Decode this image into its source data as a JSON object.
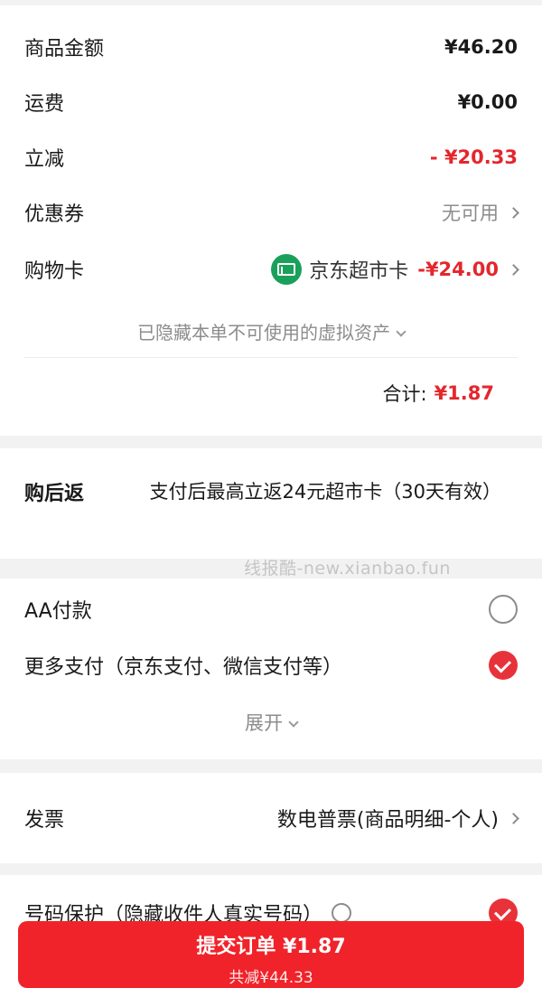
{
  "price": {
    "goods_amount_label": "商品金额",
    "goods_amount_value": "¥46.20",
    "shipping_label": "运费",
    "shipping_value": "¥0.00",
    "discount_label": "立减",
    "discount_value": "- ¥20.33",
    "coupon_label": "优惠券",
    "coupon_value": "无可用",
    "gift_card_label": "购物卡",
    "gift_card_name": "京东超市卡",
    "gift_card_value": "-¥24.00",
    "hidden_assets_text": "已隐藏本单不可使用的虚拟资产",
    "total_label": "合计:",
    "total_value": "¥1.87"
  },
  "cashback": {
    "label": "购后返",
    "text": "支付后最高立返24元超市卡（30天有效）"
  },
  "watermark": "线报酷-new.xianbao.fun",
  "payment": {
    "aa_label": "AA付款",
    "more_label": "更多支付（京东支付、微信支付等）",
    "expand_label": "展开"
  },
  "invoice": {
    "label": "发票",
    "value": "数电普票(商品明细-个人)"
  },
  "privacy": {
    "label": "号码保护（隐藏收件人真实号码）"
  },
  "submit": {
    "label": "提交订单 ¥1.87",
    "savings": "共减¥44.33"
  },
  "colors": {
    "accent_red": "#e4262d",
    "submit_bg": "#f0232a",
    "gift_card_icon": "#1aa05a"
  },
  "icons": {
    "gift_card": "gift-card-icon",
    "chevron": "chevron-right-icon",
    "expand": "chevron-down-icon"
  }
}
